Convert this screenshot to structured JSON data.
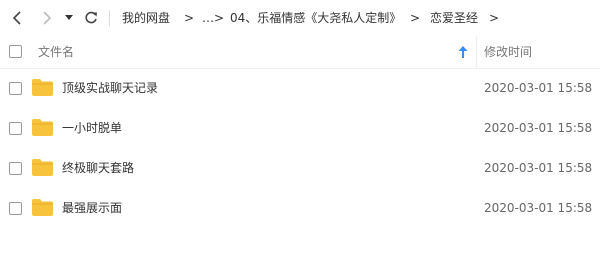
{
  "breadcrumb": {
    "items": [
      "我的网盘",
      "…",
      "04、乐福情感《大尧私人定制》",
      "恋爱圣经"
    ],
    "separator": ">"
  },
  "list": {
    "header": {
      "name_label": "文件名",
      "modified_label": "修改时间"
    },
    "rows": [
      {
        "name": "顶级实战聊天记录",
        "modified": "2020-03-01 15:58",
        "icon": "folder-icon"
      },
      {
        "name": "一小时脱单",
        "modified": "2020-03-01 15:58",
        "icon": "folder-icon"
      },
      {
        "name": "终极聊天套路",
        "modified": "2020-03-01 15:58",
        "icon": "folder-icon"
      },
      {
        "name": "最强展示面",
        "modified": "2020-03-01 15:58",
        "icon": "folder-icon"
      }
    ]
  },
  "colors": {
    "folder": "#f7c23c",
    "sort_arrow": "#3b8cf0",
    "text": "#333333"
  }
}
